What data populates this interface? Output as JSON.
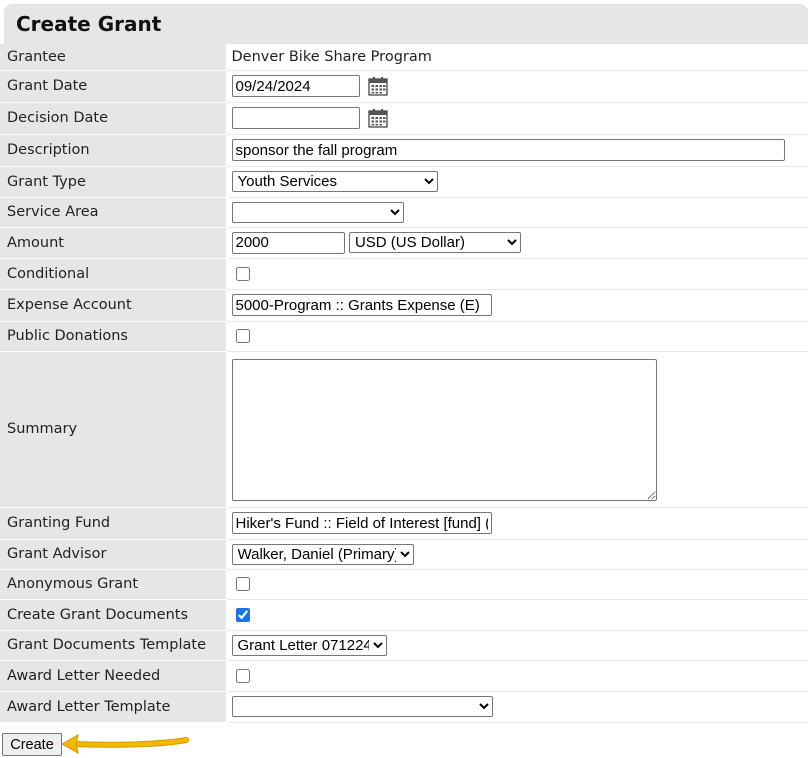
{
  "page_title": "Create Grant",
  "fields": {
    "grantee": {
      "label": "Grantee",
      "value": "Denver Bike Share Program"
    },
    "grant_date": {
      "label": "Grant Date",
      "value": "09/24/2024"
    },
    "decision_date": {
      "label": "Decision Date",
      "value": ""
    },
    "description": {
      "label": "Description",
      "value": "sponsor the fall program"
    },
    "grant_type": {
      "label": "Grant Type",
      "selected": "Youth Services"
    },
    "service_area": {
      "label": "Service Area",
      "selected": ""
    },
    "amount": {
      "label": "Amount",
      "value": "2000",
      "currency": "USD (US Dollar)"
    },
    "conditional": {
      "label": "Conditional",
      "checked": false
    },
    "expense_account": {
      "label": "Expense Account",
      "value": "5000-Program :: Grants Expense (E)"
    },
    "public_donations": {
      "label": "Public Donations",
      "checked": false
    },
    "summary": {
      "label": "Summary",
      "value": ""
    },
    "granting_fund": {
      "label": "Granting Fund",
      "value": "Hiker's Fund :: Field of Interest [fund] (1"
    },
    "grant_advisor": {
      "label": "Grant Advisor",
      "selected": "Walker, Daniel (Primary)"
    },
    "anonymous_grant": {
      "label": "Anonymous Grant",
      "checked": false
    },
    "create_grant_documents": {
      "label": "Create Grant Documents",
      "checked": true
    },
    "grant_documents_template": {
      "label": "Grant Documents Template",
      "selected": "Grant Letter 071224"
    },
    "award_letter_needed": {
      "label": "Award Letter Needed",
      "checked": false
    },
    "award_letter_template": {
      "label": "Award Letter Template",
      "selected": ""
    }
  },
  "create_button": "Create",
  "icons": {
    "calendar": "calendar-icon",
    "pointer": "arrow-pointer"
  },
  "colors": {
    "label_bg": "#e6e6e6",
    "arrow": "#f5b800",
    "checkbox": "#1a73e8"
  }
}
